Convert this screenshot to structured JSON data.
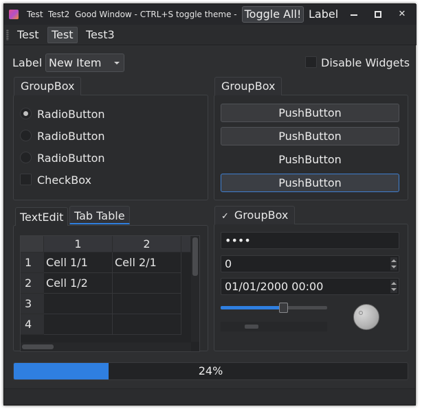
{
  "titlebar": {
    "menu_items": [
      "Test",
      "Test2"
    ],
    "title": "Good Window - CTRL+S toggle theme - C...",
    "toggle_button": "Toggle All!",
    "label": "Label",
    "close_glyph": "✕"
  },
  "toolbar": {
    "buttons": [
      "Test",
      "Test",
      "Test3"
    ]
  },
  "top_row": {
    "label": "Label",
    "combo_value": "New Item",
    "disable_checkbox_label": "Disable Widgets",
    "disable_checked": false
  },
  "left_group": {
    "title": "GroupBox",
    "radios": [
      {
        "label": "RadioButton",
        "checked": true
      },
      {
        "label": "RadioButton",
        "checked": false
      },
      {
        "label": "RadioButton",
        "checked": false
      }
    ],
    "checkbox": {
      "label": "CheckBox",
      "checked": false
    }
  },
  "right_group": {
    "title": "GroupBox",
    "buttons": [
      "PushButton",
      "PushButton",
      "PushButton",
      "PushButton"
    ]
  },
  "tabs": {
    "items": [
      "TextEdit",
      "Tab Table"
    ],
    "active": "Tab Table"
  },
  "table": {
    "columns": [
      "1",
      "2"
    ],
    "row_headers": [
      "1",
      "2",
      "3",
      "4"
    ],
    "rows": [
      [
        "Cell 1/1",
        "Cell 2/1"
      ],
      [
        "Cell 1/2",
        ""
      ],
      [
        "",
        ""
      ],
      [
        "",
        ""
      ]
    ]
  },
  "checkable_group": {
    "check_glyph": "✓",
    "title": "GroupBox",
    "checked": true,
    "password_value": "••••",
    "spin_value": "0",
    "datetime_value": "01/01/2000 00:00",
    "slider_value_percent": 58
  },
  "progress": {
    "value_percent": 24,
    "text": "24%",
    "accent_color": "#2f7fe0"
  }
}
